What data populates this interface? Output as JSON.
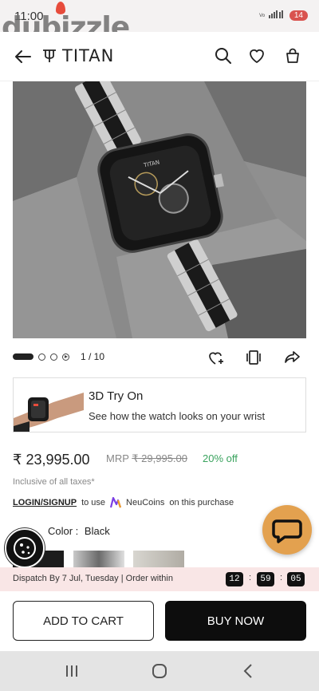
{
  "status_bar": {
    "time": "11:00",
    "battery": "14",
    "signal_text": "Vo LTE"
  },
  "watermark": {
    "text": "dubizzle"
  },
  "header": {
    "brand": "TITAN",
    "back_icon": "arrow-left-icon",
    "search_icon": "search-icon",
    "wishlist_icon": "heart-icon",
    "bag_icon": "shopping-bag-icon"
  },
  "gallery": {
    "current": "1",
    "total": "10",
    "counter": "1 / 10"
  },
  "tryon": {
    "title": "3D Try On",
    "subtitle": "See how the watch looks on your wrist"
  },
  "pricing": {
    "price": "₹ 23,995.00",
    "mrp_label": "MRP",
    "mrp_value": "₹ 29,995.00",
    "discount": "20% off",
    "taxes": "Inclusive of all taxes*"
  },
  "neucoins": {
    "login_label": "LOGIN/SIGNUP",
    "text_before": "to use",
    "brand": "NeuCoins",
    "text_after": "on this purchase"
  },
  "color": {
    "label": "Color :",
    "value": "Black"
  },
  "dispatch": {
    "text": "Dispatch By 7 Jul, Tuesday | Order within",
    "hours": "12",
    "minutes": "59",
    "seconds": "05"
  },
  "buttons": {
    "add_to_cart": "ADD TO CART",
    "buy_now": "BUY NOW"
  },
  "colors": {
    "discount_green": "#3aa35e",
    "chat_orange": "#e3a14f",
    "dispatch_bg": "#f9e6e6",
    "buy_bg": "#0d0d0d"
  }
}
